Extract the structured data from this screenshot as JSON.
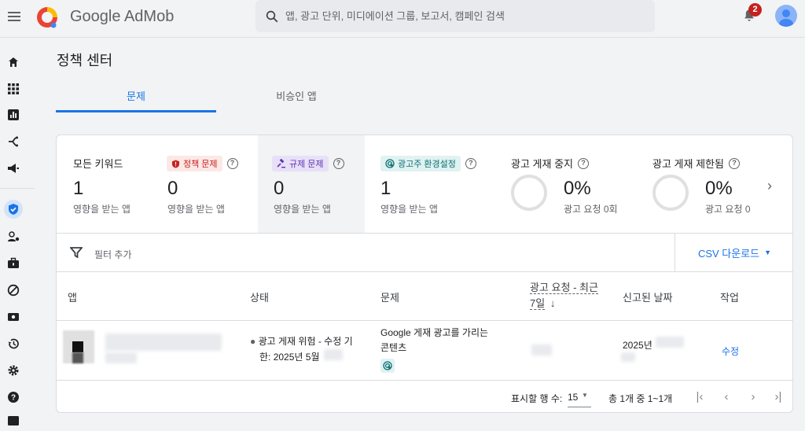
{
  "header": {
    "brand_google": "Google",
    "brand_admob": "AdMob",
    "search_placeholder": "앱, 광고 단위, 미디에이션 그룹, 보고서, 캠페인 검색",
    "notification_count": "2"
  },
  "page": {
    "title": "정책 센터",
    "tabs": [
      {
        "label": "문제"
      },
      {
        "label": "비승인 앱"
      }
    ]
  },
  "metrics": {
    "all_keywords": {
      "label": "모든 키워드",
      "value": "1",
      "sub": "영향을 받는 앱"
    },
    "policy_issues": {
      "label": "정책 문제",
      "value": "0",
      "sub": "영향을 받는 앱"
    },
    "regulatory_issues": {
      "label": "규제 문제",
      "value": "0",
      "sub": "영향을 받는 앱"
    },
    "advertiser_prefs": {
      "label": "광고주 환경설정",
      "value": "1",
      "sub": "영향을 받는 앱"
    },
    "serving_disabled": {
      "label": "광고 게재 중지",
      "value": "0%",
      "sub": "광고 요청 0회"
    },
    "serving_limited": {
      "label": "광고 게재 제한됨",
      "value": "0%",
      "sub": "광고 요청 0"
    }
  },
  "filter": {
    "add_filter": "필터 추가",
    "csv_download": "CSV 다운로드"
  },
  "table": {
    "headers": {
      "app": "앱",
      "status": "상태",
      "issue": "문제",
      "ad_requests_line1": "광고 요청 - 최근",
      "ad_requests_line2": "7일",
      "reported_date": "신고된 날짜",
      "action": "작업"
    },
    "rows": [
      {
        "status_line1": "광고 게재 위험 - 수정 기",
        "status_line2": "한: 2025년 5월",
        "issue": "Google 게재 광고를 가리는",
        "issue_line2": "콘텐츠",
        "reported_date": "2025년",
        "action": "수정"
      }
    ]
  },
  "pager": {
    "rows_per_page_label": "표시할 행 수:",
    "rows_per_page": "15",
    "range": "총 1개 중 1~1개"
  },
  "colors": {
    "accent": "#1a73e8",
    "badge_red": "#c5221f",
    "policy_chip_bg": "#fce8e6",
    "regulatory_chip_bg": "#e8e0f8",
    "advertiser_chip_bg": "#e0f2f1"
  }
}
